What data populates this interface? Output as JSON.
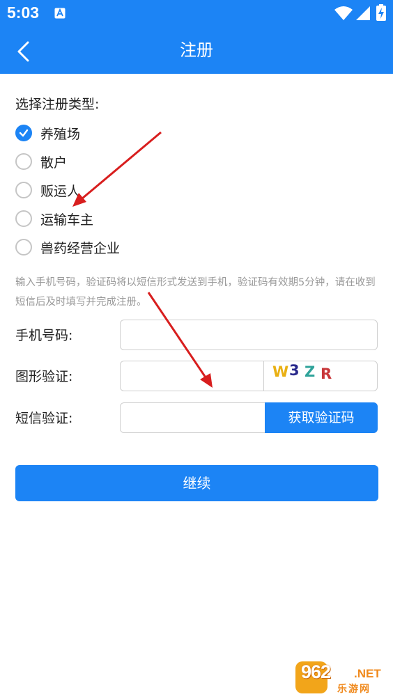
{
  "status_bar": {
    "time": "5:03"
  },
  "header": {
    "title": "注册"
  },
  "register_type": {
    "label": "选择注册类型:",
    "options": [
      {
        "label": "养殖场",
        "checked": true
      },
      {
        "label": "散户",
        "checked": false
      },
      {
        "label": "贩运人",
        "checked": false
      },
      {
        "label": "运输车主",
        "checked": false
      },
      {
        "label": "兽药经营企业",
        "checked": false
      }
    ]
  },
  "hint": "输入手机号码，验证码将以短信形式发送到手机，验证码有效期5分钟，请在收到短信后及时填写并完成注册。",
  "form": {
    "phone_label": "手机号码:",
    "phone_value": "",
    "captcha_label": "图形验证:",
    "captcha_value": "",
    "captcha_chars": [
      {
        "char": "W",
        "color": "#e9b013"
      },
      {
        "char": "3",
        "color": "#2a2a8c"
      },
      {
        "char": "Z",
        "color": "#2fa39a"
      },
      {
        "char": "R",
        "color": "#c8373a"
      }
    ],
    "sms_label": "短信验证:",
    "sms_value": "",
    "sms_button": "获取验证码"
  },
  "continue_button": "继续",
  "watermark": {
    "big": "962",
    "net": ".NET",
    "sub": "乐游网"
  },
  "colors": {
    "primary": "#1c84f5",
    "annotation_arrow": "#d81e1e"
  }
}
